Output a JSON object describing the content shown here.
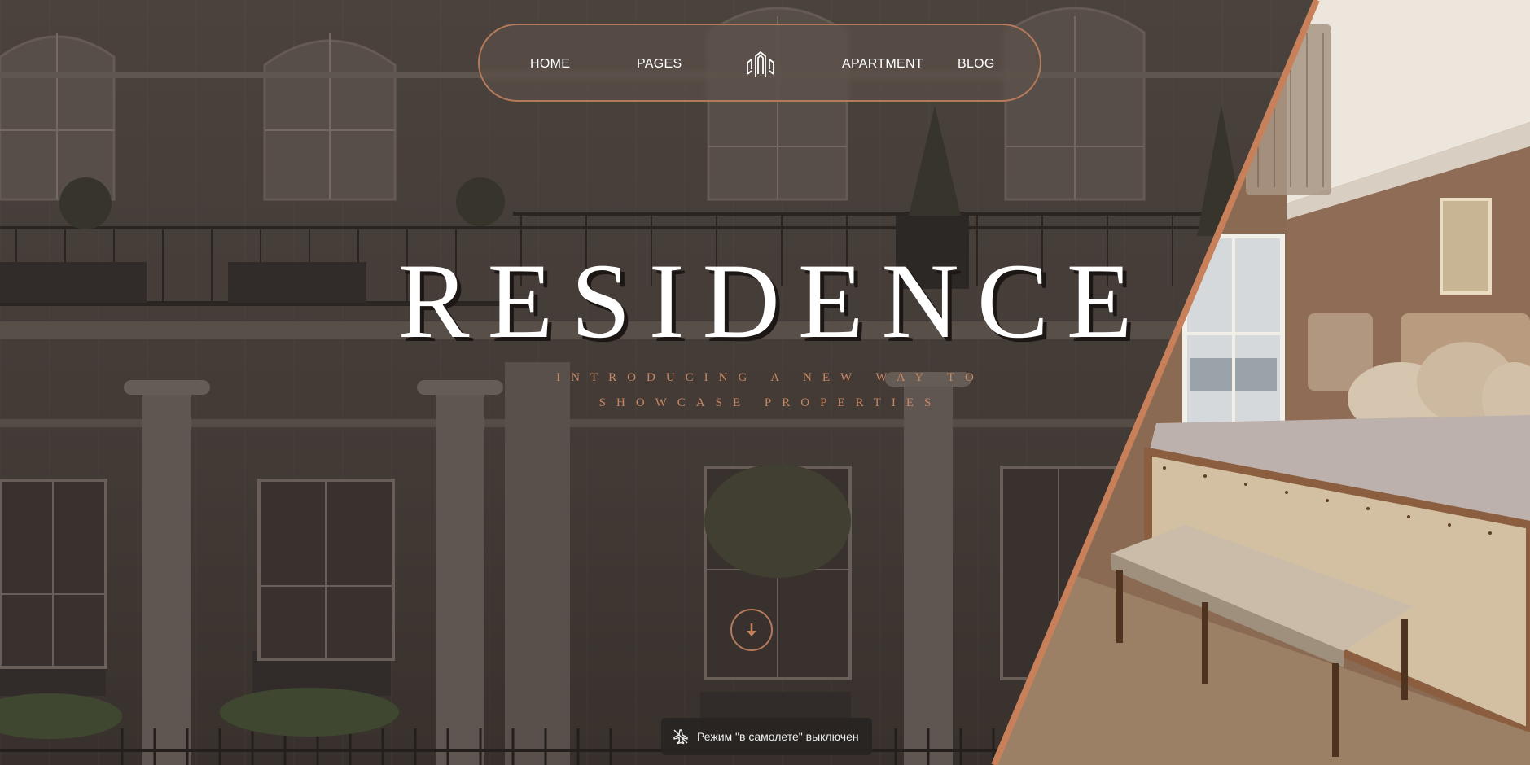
{
  "nav": {
    "items": [
      {
        "label": "HOME"
      },
      {
        "label": "PAGES"
      },
      {
        "label": "APARTMENT"
      },
      {
        "label": "BLOG"
      }
    ],
    "logo_icon": "building-columns-logo-icon"
  },
  "hero": {
    "title": "RESIDENCE",
    "subtitle_line1": "INTRODUCING A NEW WAY TO",
    "subtitle_line2": "SHOWCASE PROPERTIES",
    "scroll_icon": "arrow-down-icon"
  },
  "toast": {
    "text": "Режим \"в самолете\" выключен",
    "icon": "airplane-off-icon"
  },
  "colors": {
    "accent": "#b37a5b",
    "subtitle": "#c88762",
    "title": "#ffffff",
    "overlay": "#2d2621"
  }
}
